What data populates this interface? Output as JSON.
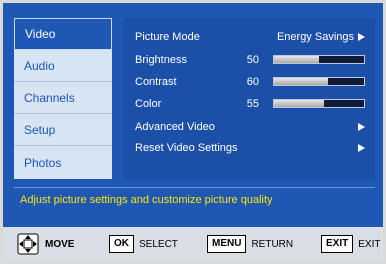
{
  "sidebar": {
    "items": [
      {
        "label": "Video",
        "active": true
      },
      {
        "label": "Audio",
        "active": false
      },
      {
        "label": "Channels",
        "active": false
      },
      {
        "label": "Setup",
        "active": false
      },
      {
        "label": "Photos",
        "active": false
      }
    ]
  },
  "video_menu": {
    "picture_mode": {
      "label": "Picture Mode",
      "value": "Energy Savings"
    },
    "brightness": {
      "label": "Brightness",
      "value": "50",
      "level": 0.5
    },
    "contrast": {
      "label": "Contrast",
      "value": "60",
      "level": 0.6
    },
    "color": {
      "label": "Color",
      "value": "55",
      "level": 0.55
    },
    "advanced_video": {
      "label": "Advanced Video"
    },
    "reset_video": {
      "label": "Reset Video Settings"
    }
  },
  "help_text": "Adjust picture settings and customize picture quality",
  "footer": {
    "move_label": "MOVE",
    "ok_key": "OK",
    "ok_label": "SELECT",
    "menu_key": "MENU",
    "menu_label": "RETURN",
    "exit_key": "EXIT",
    "exit_label": "EXIT"
  },
  "colors": {
    "background": "#1f57b4",
    "sidebar": "#d6e4f3",
    "help_text": "#ffe500",
    "footer": "#d9dde4"
  },
  "icons": {
    "move": "dpad-arrows-icon",
    "submenu": "right-triangle-icon"
  }
}
